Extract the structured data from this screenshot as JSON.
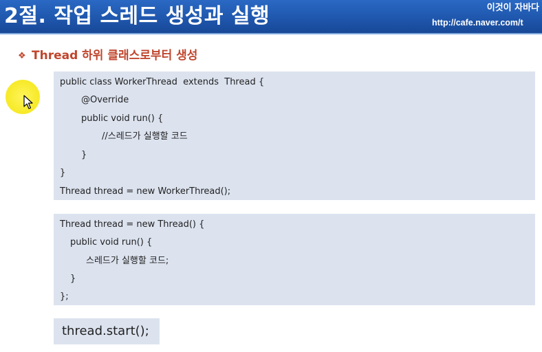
{
  "header": {
    "title": "2절. 작업 스레드 생성과 실행",
    "brand_name": "이것이 자바다",
    "brand_url": "http://cafe.naver.com/t"
  },
  "subtitle": {
    "bullet": "❖",
    "text": "Thread 하위 클래스로부터 생성"
  },
  "code_blocks": [
    {
      "lines": [
        "public class WorkerThread  extends  Thread {",
        "@Override",
        "public void run() {",
        "//스레드가 실행할 코드",
        "}",
        "}",
        "Thread thread = new WorkerThread();"
      ]
    },
    {
      "lines": [
        "Thread thread = new Thread() {",
        "public void run() {",
        "스레드가 실행할 코드;",
        "}",
        "};"
      ]
    },
    {
      "lines": [
        "thread.start();"
      ]
    }
  ],
  "colors": {
    "header_bg": "#1f57ad",
    "subtitle": "#c0452c",
    "code_box_bg": "#dce3ef",
    "cursor_highlight": "#f7ea2a"
  },
  "icons": {
    "cursor": "mouse-pointer-icon",
    "bullet": "diamond-bullet-icon"
  }
}
